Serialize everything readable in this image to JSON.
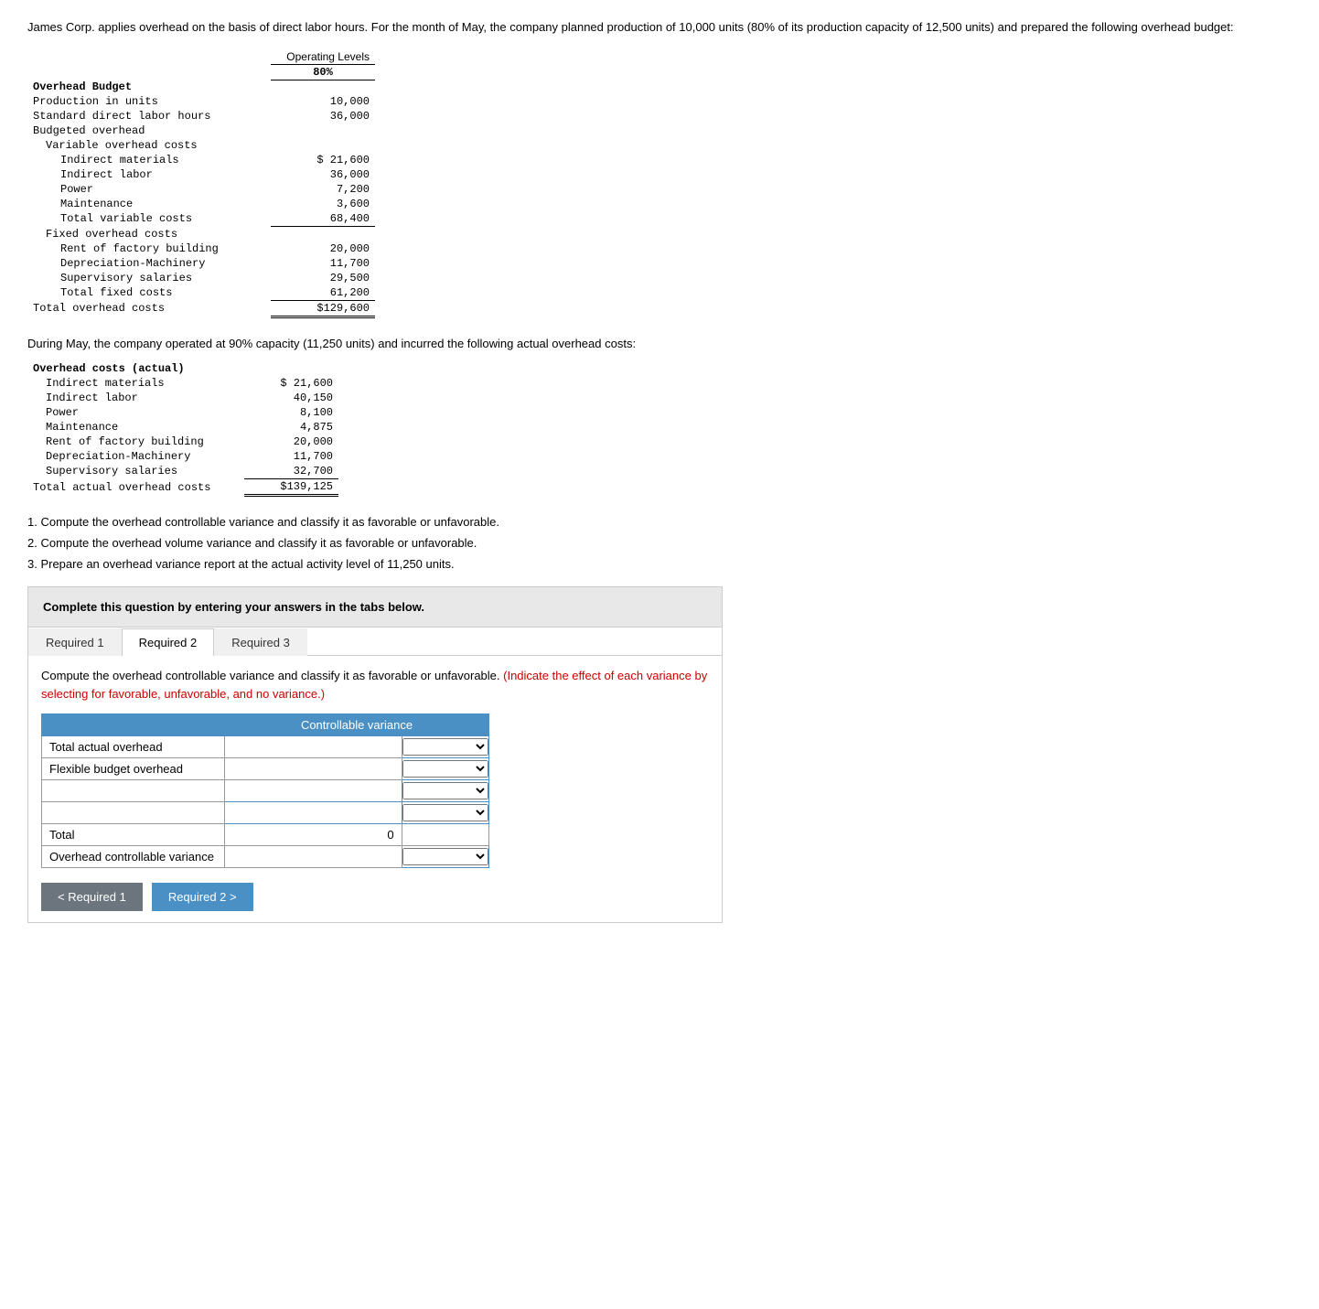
{
  "intro": {
    "text": "James Corp. applies overhead on the basis of direct labor hours. For the month of May, the company planned production of 10,000 units (80% of its production capacity of 12,500 units) and prepared the following overhead budget:"
  },
  "budget_table": {
    "header": "Operating Levels",
    "col_header": "80%",
    "rows": [
      {
        "label": "Overhead Budget",
        "value": "",
        "indent": 0,
        "bold": true
      },
      {
        "label": "Production in units",
        "value": "10,000",
        "indent": 0
      },
      {
        "label": "Standard direct labor hours",
        "value": "36,000",
        "indent": 0
      },
      {
        "label": "Budgeted overhead",
        "value": "",
        "indent": 0
      },
      {
        "label": "Variable overhead costs",
        "value": "",
        "indent": 1
      },
      {
        "label": "Indirect materials",
        "value": "$ 21,600",
        "indent": 2
      },
      {
        "label": "Indirect labor",
        "value": "36,000",
        "indent": 2
      },
      {
        "label": "Power",
        "value": "7,200",
        "indent": 2
      },
      {
        "label": "Maintenance",
        "value": "3,600",
        "indent": 2
      },
      {
        "label": "Total variable costs",
        "value": "68,400",
        "indent": 2,
        "underline": "single"
      },
      {
        "label": "Fixed overhead costs",
        "value": "",
        "indent": 1
      },
      {
        "label": "Rent of factory building",
        "value": "20,000",
        "indent": 2
      },
      {
        "label": "Depreciation-Machinery",
        "value": "11,700",
        "indent": 2
      },
      {
        "label": "Supervisory salaries",
        "value": "29,500",
        "indent": 2
      },
      {
        "label": "Total fixed costs",
        "value": "61,200",
        "indent": 2,
        "underline": "single"
      },
      {
        "label": "Total overhead costs",
        "value": "$129,600",
        "indent": 0,
        "underline": "double"
      }
    ]
  },
  "actual_section": {
    "intro": "During May, the company operated at 90% capacity (11,250 units) and incurred the following actual overhead costs:",
    "table": {
      "rows": [
        {
          "label": "Overhead costs (actual)",
          "value": "",
          "indent": 0,
          "bold": true
        },
        {
          "label": "Indirect materials",
          "value": "$ 21,600",
          "indent": 1
        },
        {
          "label": "Indirect labor",
          "value": "40,150",
          "indent": 1
        },
        {
          "label": "Power",
          "value": "8,100",
          "indent": 1
        },
        {
          "label": "Maintenance",
          "value": "4,875",
          "indent": 1
        },
        {
          "label": "Rent of factory building",
          "value": "20,000",
          "indent": 1
        },
        {
          "label": "Depreciation-Machinery",
          "value": "11,700",
          "indent": 1
        },
        {
          "label": "Supervisory salaries",
          "value": "32,700",
          "indent": 1,
          "underline": "single"
        },
        {
          "label": "Total actual overhead costs",
          "value": "$139,125",
          "indent": 0,
          "underline": "double"
        }
      ]
    }
  },
  "instructions": [
    "1. Compute the overhead controllable variance and classify it as favorable or unfavorable.",
    "2. Compute the overhead volume variance and classify it as favorable or unfavorable.",
    "3. Prepare an overhead variance report at the actual activity level of 11,250 units."
  ],
  "complete_box": {
    "text": "Complete this question by entering your answers in the tabs below."
  },
  "tabs": [
    {
      "id": "req1",
      "label": "Required 1",
      "active": false
    },
    {
      "id": "req2",
      "label": "Required 2",
      "active": true
    },
    {
      "id": "req3",
      "label": "Required 3",
      "active": false
    }
  ],
  "tab_content": {
    "description_normal": "Compute the overhead controllable variance and classify it as favorable or unfavorable.",
    "description_red": "(Indicate the effect of each variance by selecting for favorable, unfavorable, and no variance.)",
    "controllable_variance_header": "Controllable variance",
    "table_rows": [
      {
        "label": "Total actual overhead",
        "col1_val": "",
        "col2_val": "",
        "has_input1": false,
        "has_input2": true
      },
      {
        "label": "Flexible budget overhead",
        "col1_val": "",
        "col2_val": "",
        "has_input1": false,
        "has_input2": true
      },
      {
        "label": "",
        "col1_val": "",
        "col2_val": "",
        "has_input1": true,
        "has_input2": true
      },
      {
        "label": "",
        "col1_val": "",
        "col2_val": "",
        "has_input1": true,
        "has_input2": true
      },
      {
        "label": "Total",
        "col1_val": "0",
        "col2_val": "",
        "has_input1": false,
        "has_input2": false,
        "is_total": true
      },
      {
        "label": "Overhead controllable variance",
        "col1_val": "",
        "col2_val": "",
        "has_input1": false,
        "has_input2": true
      }
    ]
  },
  "nav": {
    "prev_label": "< Required 1",
    "next_label": "Required 2 >"
  }
}
